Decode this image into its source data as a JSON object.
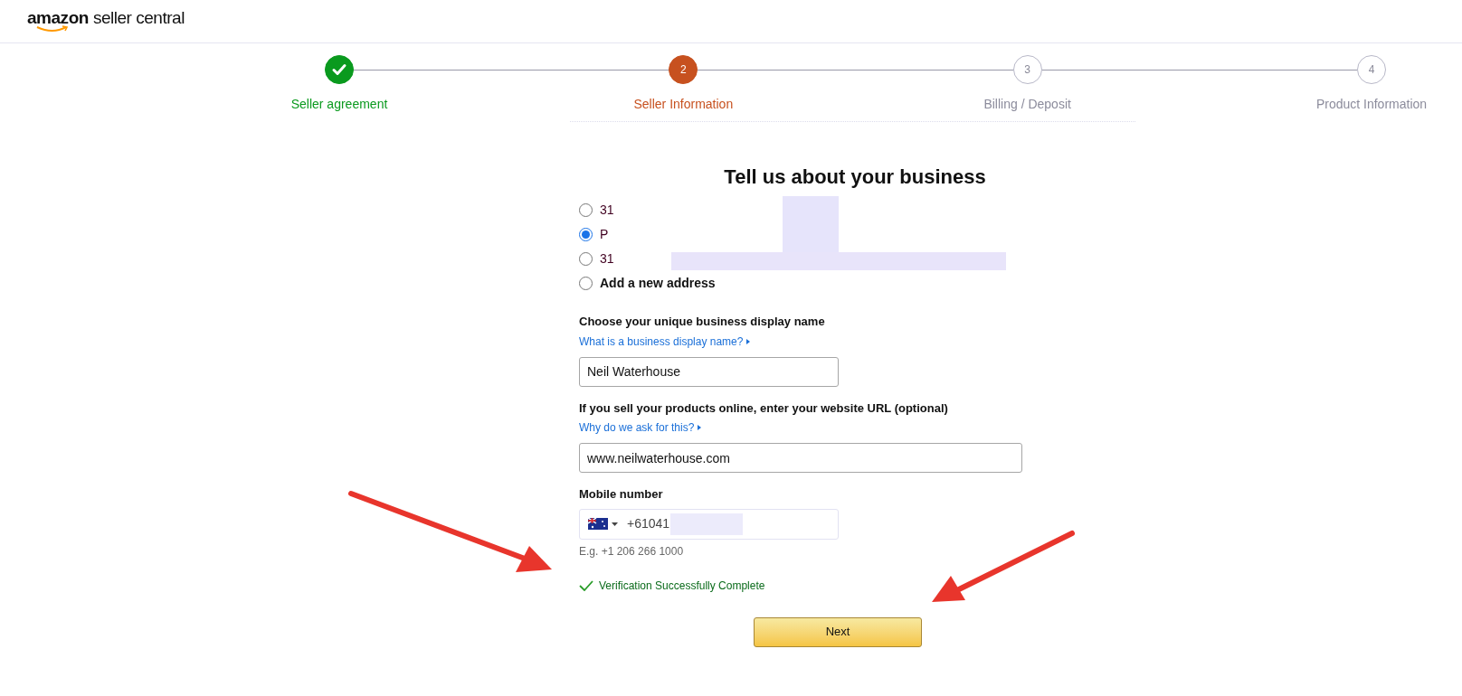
{
  "header": {
    "logo_brand": "amazon",
    "logo_product": "seller central"
  },
  "steps": [
    {
      "label": "Seller agreement",
      "completed": true,
      "selected": false
    },
    {
      "label": "Seller Information",
      "number": "2",
      "completed": false,
      "selected": true
    },
    {
      "label": "Billing / Deposit",
      "number": "3",
      "completed": false,
      "selected": false
    },
    {
      "label": "Product Information",
      "number": "4",
      "completed": false,
      "selected": false
    }
  ],
  "form": {
    "title": "Tell us about your business",
    "addresses": [
      {
        "label": "31",
        "selected": false
      },
      {
        "label": "P",
        "selected": true
      },
      {
        "label": "31",
        "selected": false
      },
      {
        "label": "Add a new address",
        "selected": false
      }
    ],
    "display_name": {
      "label": "Choose your unique business display name",
      "help_link": "What is a business display name?",
      "value": "Neil Waterhouse"
    },
    "website": {
      "label": "If you sell your products online, enter your website URL (optional)",
      "help_link": "Why do we ask for this?",
      "value": "www.neilwaterhouse.com"
    },
    "mobile": {
      "label": "Mobile number",
      "value": "+61041",
      "hint": "E.g. +1 206 266 1000"
    },
    "verification": "Verification Successfully Complete",
    "next_button": "Next"
  }
}
